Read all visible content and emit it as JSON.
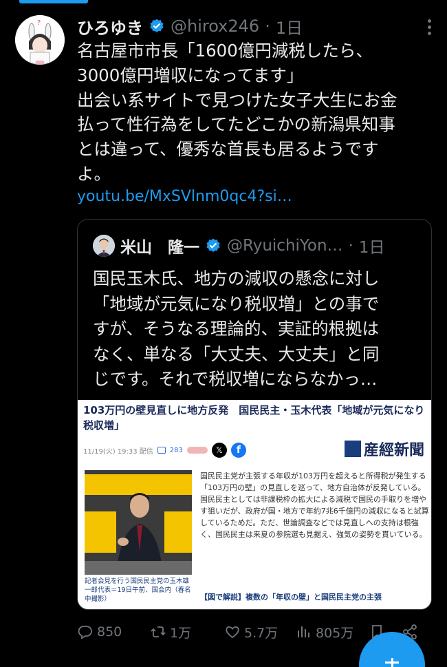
{
  "tweet": {
    "author_name": "ひろゆき",
    "handle": "@hirox246",
    "separator": "·",
    "time": "1日",
    "lines": [
      "名古屋市市長「1600億円減税したら、",
      "3000億円増収になってます」",
      "出会い系サイトで見つけた女子大生にお金",
      "払って性行為をしてたどこかの新潟県知事",
      "とは違って、優秀な首長も居るようです",
      "よ。"
    ],
    "link": "youtu.be/MxSVlnm0qc4?si…"
  },
  "quote": {
    "author_name": "米山　隆一",
    "handle": "@RyuichiYon…",
    "separator": "·",
    "time": "1日",
    "lines": [
      "国民玉木氏、地方の減収の懸念に対し",
      "「地域が元気になり税収増」との事で",
      "すが、そうなる理論的、実証的根拠は",
      "なく、単なる「大丈夫、大丈夫」と同",
      "じです。それで税収増にならなかっ…"
    ],
    "article": {
      "title": "103万円の壁見直しに地方反発　国民民主・玉木代表「地域が元気になり税収増」",
      "date": "11/19(火) 19:33 配信",
      "comments": "283",
      "publisher": "産經新聞",
      "caption": "記者会見を行う国民民主党の玉木雄一郎代表＝19日午前、国会内（春名中撮影）",
      "body": "国民民主党が主張する年収が103万円を超えると所得税が発生する「103万円の壁」の見直しを巡って、地方自治体が反発している。国民民主としては非課税枠の拡大による減税で国民の手取りを増やす狙いだが、政府が国・地方で年約7兆6千億円の減収になると試算しているためだ。ただ、世論調査などでは見直しへの支持は根強く、国民民主は来夏の参院選も見据え、強気の姿勢を貫いている。",
      "related": "【図で解説】複数の「年収の壁」と国民民主党の主張"
    }
  },
  "actions": {
    "replies": "850",
    "retweets": "1万",
    "likes": "5.7万",
    "views": "805万"
  },
  "colors": {
    "background": "#000000",
    "text": "#e7e9ea",
    "muted": "#71767b",
    "accent": "#1d9bf0",
    "border": "#2f3336"
  }
}
